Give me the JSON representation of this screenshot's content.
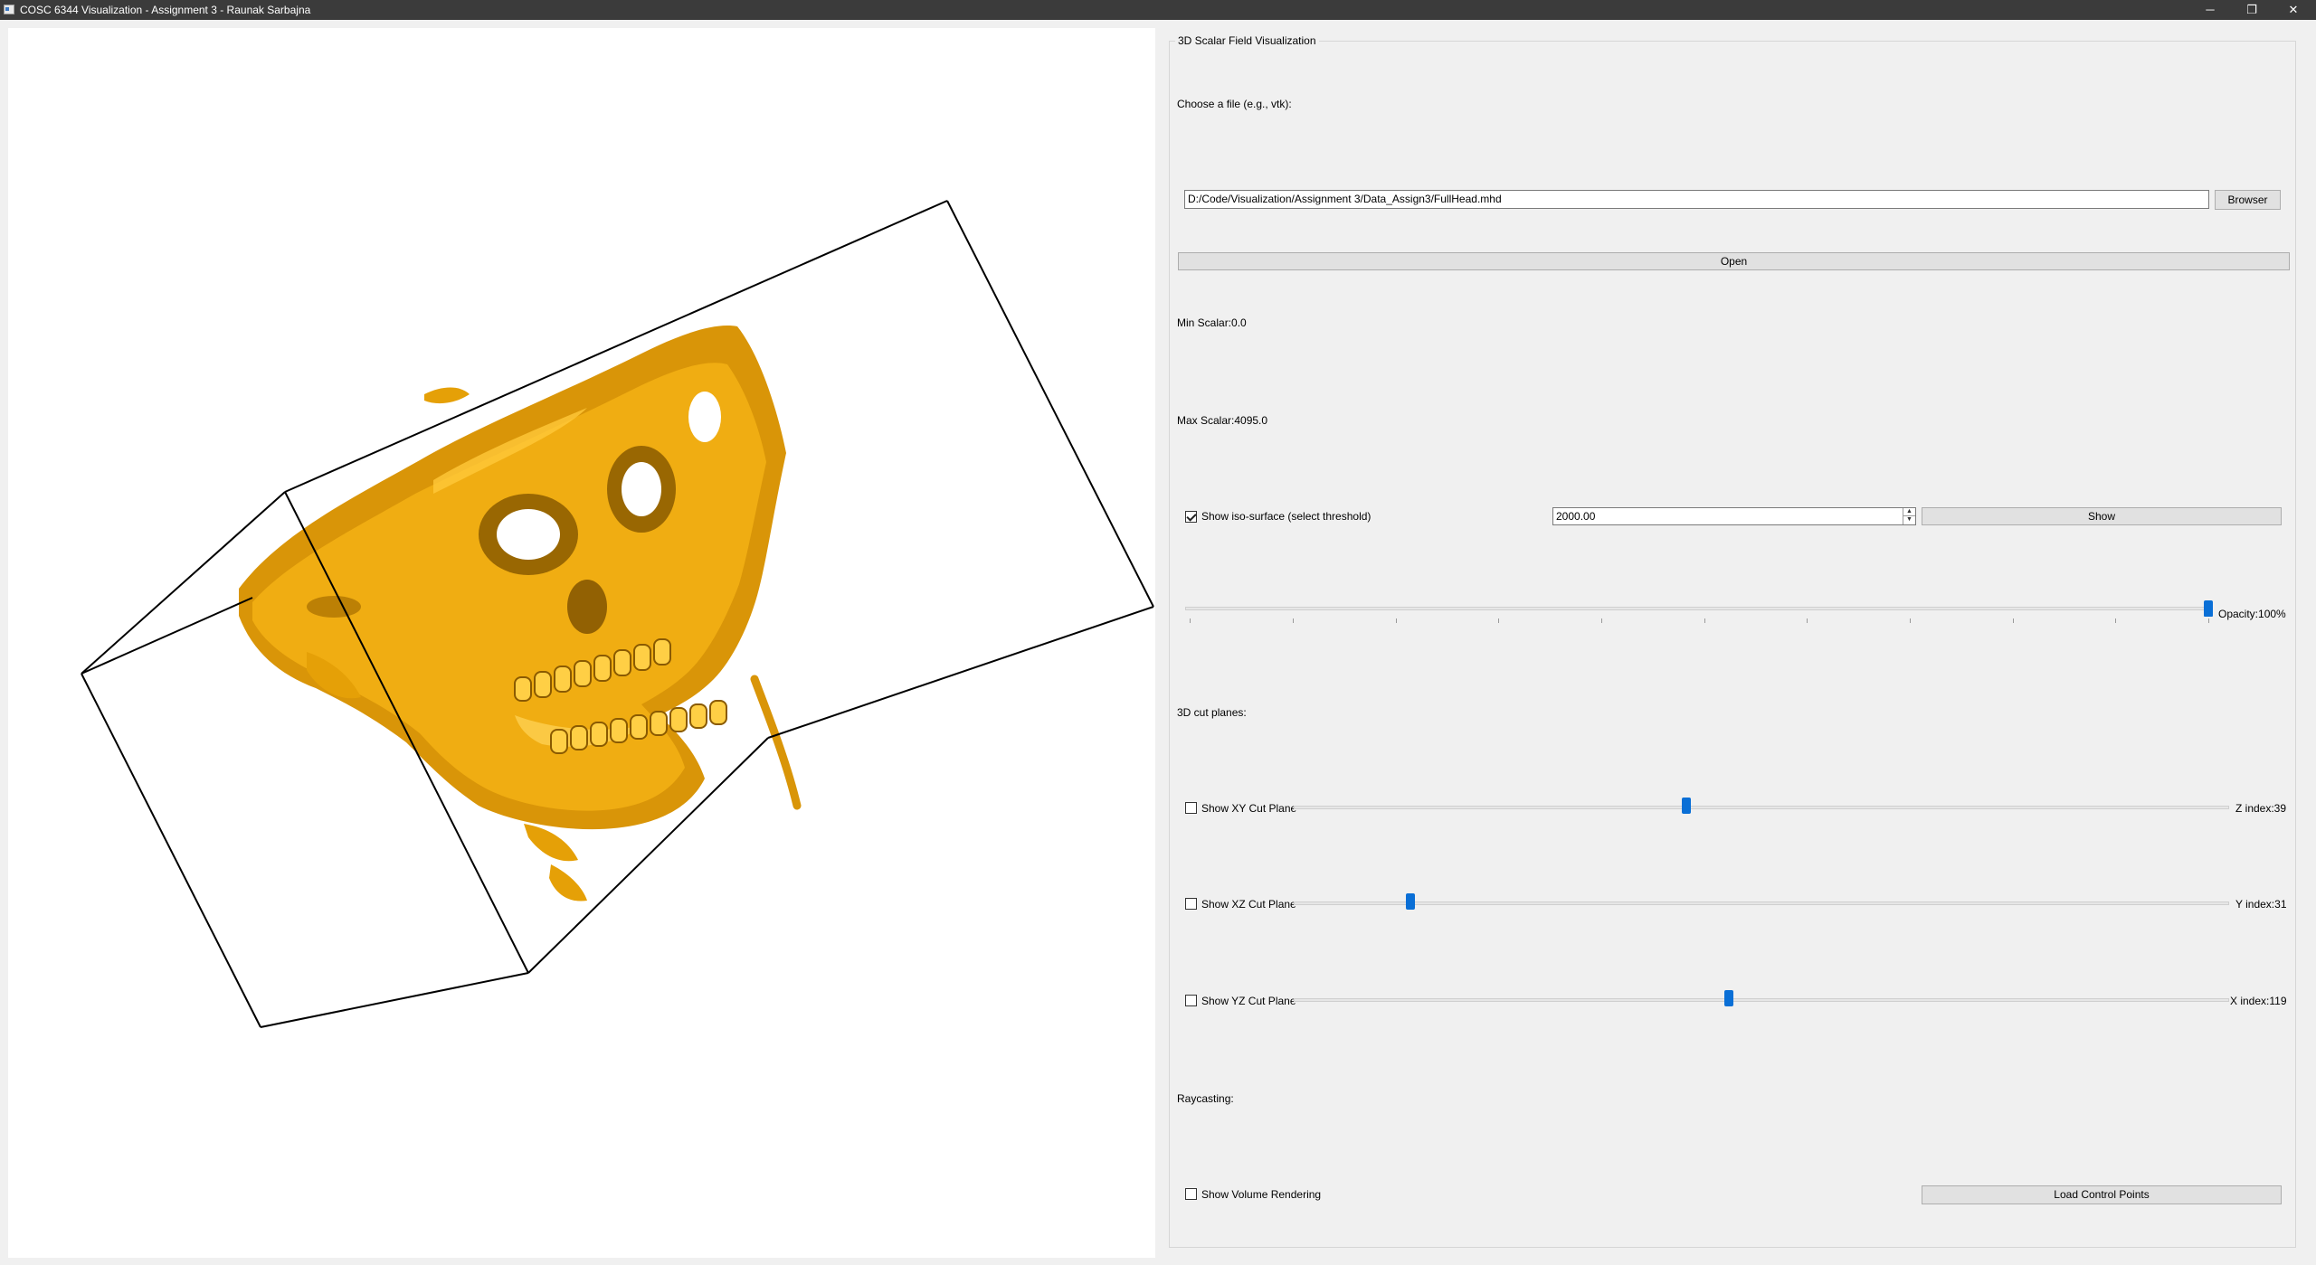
{
  "window": {
    "title": "COSC 6344 Visualization - Assignment 3 - Raunak Sarbajna",
    "minimize_glyph": "─",
    "restore_glyph": "❐",
    "close_glyph": "✕"
  },
  "viewport": {
    "scene": "volume-isosurface-skull",
    "surface_color": "#e5a007",
    "background_color": "#ffffff"
  },
  "panel": {
    "title": "3D Scalar Field Visualization",
    "file_prompt": "Choose a file (e.g., vtk):",
    "file_path": "D:/Code/Visualization/Assignment 3/Data_Assign3/FullHead.mhd",
    "browse_label": "Browser",
    "open_label": "Open",
    "min_scalar": "Min Scalar:0.0",
    "max_scalar": "Max Scalar:4095.0",
    "iso": {
      "checkbox_label": "Show iso-surface (select threshold)",
      "checked": true,
      "threshold_value": "2000.00",
      "show_label": "Show"
    },
    "opacity": {
      "label": "Opacity:100%",
      "value_percent": 100
    },
    "cut_planes": {
      "heading": "3D cut planes:",
      "planes": [
        {
          "label": "Show XY Cut Plane",
          "checked": false,
          "index_label": "Z index:39",
          "slider_fraction": 0.42
        },
        {
          "label": "Show XZ Cut Plane",
          "checked": false,
          "index_label": "Y index:31",
          "slider_fraction": 0.125
        },
        {
          "label": "Show YZ Cut Plane",
          "checked": false,
          "index_label": "X index:119",
          "slider_fraction": 0.465
        }
      ]
    },
    "raycasting": {
      "heading": "Raycasting:",
      "checkbox_label": "Show Volume Rendering",
      "checked": false,
      "load_label": "Load Control Points"
    }
  },
  "colors": {
    "accent": "#0a6fd6",
    "titlebar": "#3b3b3b",
    "panel_bg": "#f0f0f0"
  }
}
